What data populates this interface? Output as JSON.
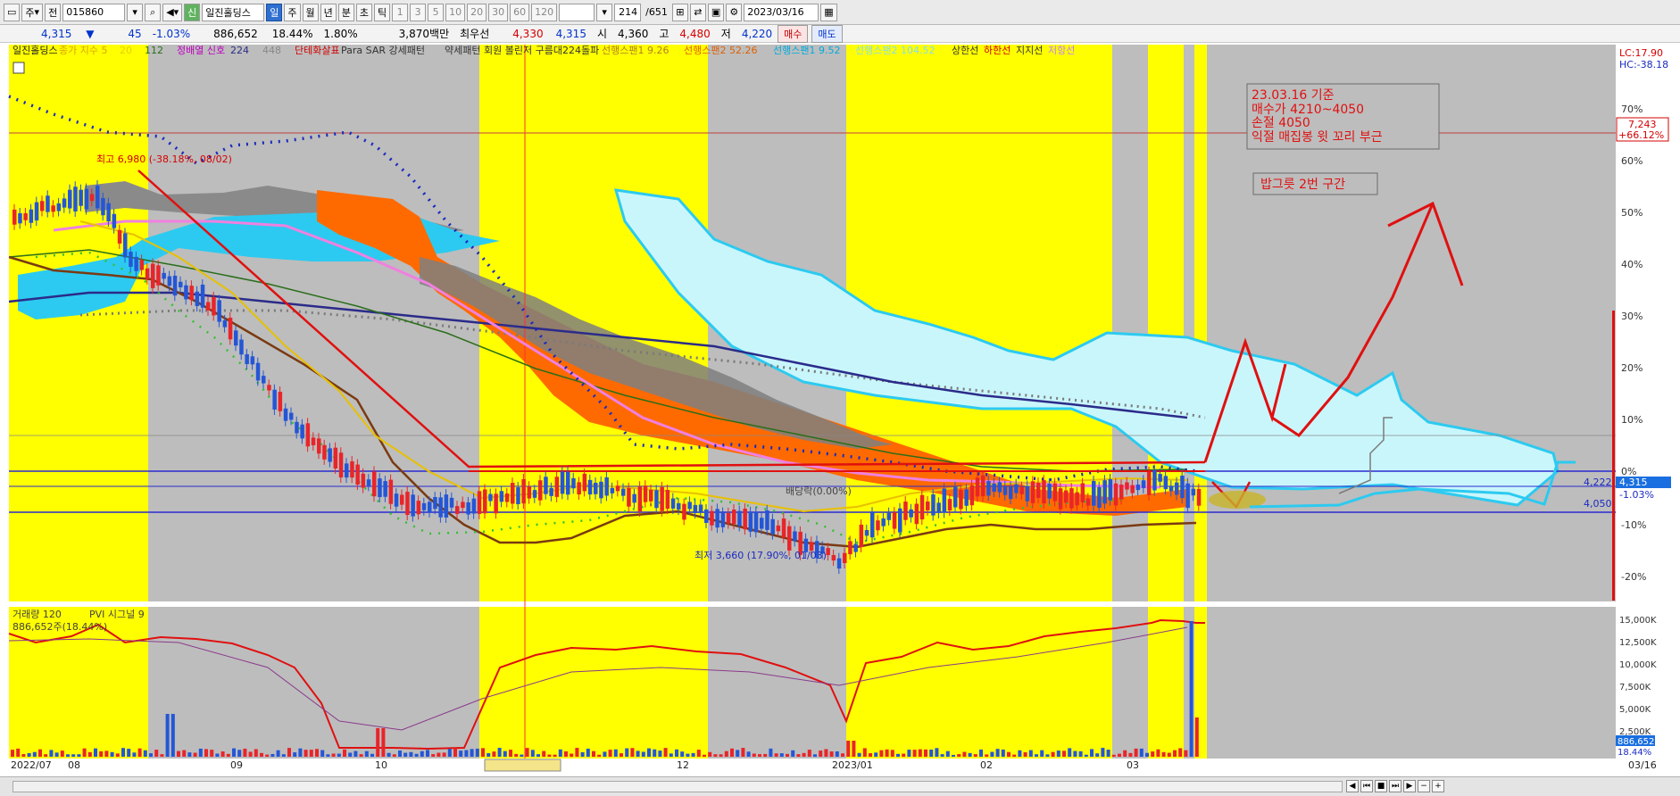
{
  "toolbar": {
    "period_btn": "주",
    "market_btn": "전",
    "code": "015860",
    "stock_name": "일진홀딩스",
    "stock_tag": "신",
    "periods": [
      "일",
      "주",
      "월",
      "년",
      "분",
      "초",
      "틱"
    ],
    "active_period": "일",
    "intervals": [
      "1",
      "3",
      "5",
      "10",
      "20",
      "30",
      "60",
      "120"
    ],
    "count": "214",
    "total": "/651",
    "date": "2023/03/16"
  },
  "quote": {
    "price": "4,315",
    "arrow": "▼",
    "change": "45",
    "change_pct": "-1.03%",
    "volume": "886,652",
    "volume_pct": "18.44%",
    "turnover_pct": "1.80%",
    "amount": "3,870백만",
    "pref_label": "최우선",
    "pref_value": "4,330",
    "pref_value2": "4,315",
    "open_label": "시",
    "open": "4,360",
    "high_label": "고",
    "high": "4,480",
    "low_label": "저",
    "low": "4,220",
    "buy": "매수",
    "sell": "매도"
  },
  "legend": [
    {
      "text": "일진홀딩스",
      "color": "#222222"
    },
    {
      "text": "종가 지수 5",
      "color": "#d9a400"
    },
    {
      "text": "20",
      "color": "#e8d000"
    },
    {
      "text": "112",
      "color": "#2a6e1a"
    },
    {
      "text": "정배열 신호",
      "color": "#c000c0"
    },
    {
      "text": "224",
      "color": "#2b2b8a"
    },
    {
      "text": "448",
      "color": "#888888"
    },
    {
      "text": "단테화살표",
      "color": "#d40000"
    },
    {
      "text": "Para SAR 강세패턴",
      "color": "#333333"
    },
    {
      "text": "약세패턴",
      "color": "#333333"
    },
    {
      "text": "회원 볼린저 구름대224돌파",
      "color": "#333333"
    },
    {
      "text": "선행스팬1 9.26",
      "color": "#b08020"
    },
    {
      "text": "선행스팬2 52.26",
      "color": "#e06000"
    },
    {
      "text": "선행스팬1 9.52",
      "color": "#00aadd"
    },
    {
      "text": "선행스팬2 104.52",
      "color": "#88ddee"
    },
    {
      "text": "상한선",
      "color": "#333333"
    },
    {
      "text": "하한선",
      "color": "#d40000"
    },
    {
      "text": "지지선",
      "color": "#333333"
    },
    {
      "text": "저항선",
      "color": "#c080ff"
    }
  ],
  "annotations": {
    "high_marker": "최고 6,980 (-38.18%, 08/02)",
    "low_marker": "최저 3,660 (17.90%, 01/03)",
    "dividend": "배당락(0.00%)",
    "note_lines": [
      "23.03.16 기준",
      "매수가 4210~4050",
      "손절 4050",
      "익절 매집봉 윗 꼬리 부근"
    ],
    "note2": "밥그릇 2번 구간"
  },
  "right_axis": {
    "lc": "LC:17.90",
    "hc": "HC:-38.18",
    "pct_ticks": [
      "70%",
      "60%",
      "50%",
      "40%",
      "30%",
      "20%",
      "10%",
      "0%",
      "-10%",
      "-20%"
    ],
    "price_box": "7,243",
    "price_box_pct": "+66.12%",
    "current_price": "4,315",
    "current_pct": "-1.03%",
    "level_4222": "4,222",
    "level_4050": "4,050"
  },
  "volume_panel": {
    "legend_volume": "거래량 120",
    "legend_pvi": "PVI 시그널 9",
    "legend_value": "886,652주(18.44%)",
    "ticks": [
      "15,000K",
      "12,500K",
      "10,000K",
      "7,500K",
      "5,000K",
      "2,500K"
    ],
    "current_vol": "886,652",
    "current_pct": "18.44%"
  },
  "x_axis": {
    "labels": [
      "2022/07",
      "08",
      "09",
      "10",
      "2022/11/02(수)",
      "12",
      "2023/01",
      "02",
      "03"
    ],
    "right_date": "03/16"
  },
  "colors": {
    "highlight_yellow": "#ffff00",
    "gray_band": "#bdbdbd",
    "cloud_light": "#c9f6fb",
    "cloud_orange": "#ff6a00",
    "cloud_blue": "#2ccaf0",
    "up_candle": "#e8252a",
    "down_candle": "#2456d6"
  }
}
